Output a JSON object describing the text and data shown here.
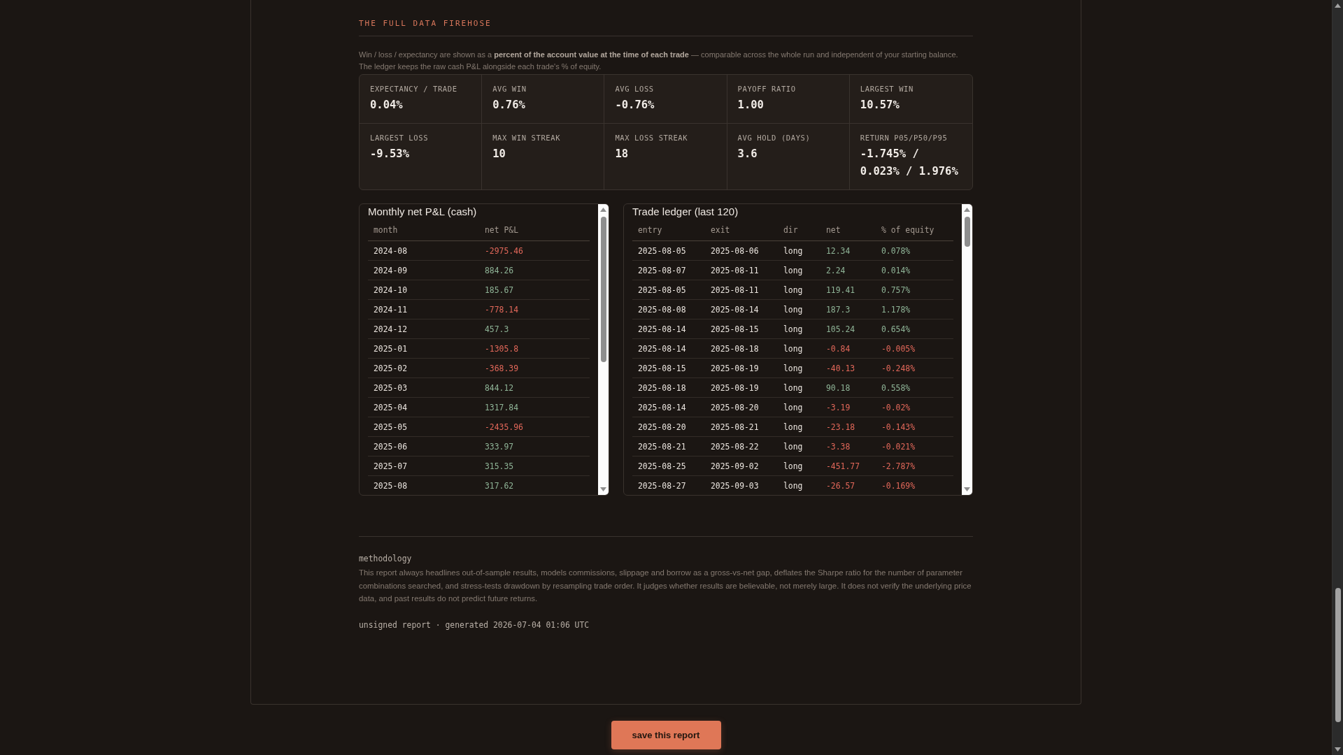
{
  "section": {
    "title": "THE FULL DATA FIREHOSE",
    "intro": "Win / loss / expectancy are shown as a **percent of the account value at the time of each trade** — comparable across the whole run and independent of your starting balance. The ledger keeps the raw cash P&L alongside each trade's % of equity."
  },
  "stats": [
    {
      "label": "EXPECTANCY / TRADE",
      "value": "0.04%"
    },
    {
      "label": "AVG WIN",
      "value": "0.76%"
    },
    {
      "label": "AVG LOSS",
      "value": "-0.76%"
    },
    {
      "label": "PAYOFF RATIO",
      "value": "1.00"
    },
    {
      "label": "LARGEST WIN",
      "value": "10.57%"
    },
    {
      "label": "LARGEST LOSS",
      "value": "-9.53%"
    },
    {
      "label": "MAX WIN STREAK",
      "value": "10"
    },
    {
      "label": "MAX LOSS STREAK",
      "value": "18"
    },
    {
      "label": "AVG HOLD (DAYS)",
      "value": "3.6"
    },
    {
      "label": "RETURN P05/P50/P95",
      "value": "-1.745% / 0.023% / 1.976%"
    }
  ],
  "monthly_table": {
    "title": "Monthly net P&L (cash)",
    "columns": [
      "month",
      "net P&L"
    ],
    "rows": [
      {
        "month": "2024-08",
        "net": "-2975.46",
        "negative": true
      },
      {
        "month": "2024-09",
        "net": "884.26",
        "negative": false
      },
      {
        "month": "2024-10",
        "net": "185.67",
        "negative": false
      },
      {
        "month": "2024-11",
        "net": "-778.14",
        "negative": true
      },
      {
        "month": "2024-12",
        "net": "457.3",
        "negative": false
      },
      {
        "month": "2025-01",
        "net": "-1305.8",
        "negative": true
      },
      {
        "month": "2025-02",
        "net": "-368.39",
        "negative": true
      },
      {
        "month": "2025-03",
        "net": "844.12",
        "negative": false
      },
      {
        "month": "2025-04",
        "net": "1317.84",
        "negative": false
      },
      {
        "month": "2025-05",
        "net": "-2435.96",
        "negative": true
      },
      {
        "month": "2025-06",
        "net": "333.97",
        "negative": false
      },
      {
        "month": "2025-07",
        "net": "315.35",
        "negative": false
      },
      {
        "month": "2025-08",
        "net": "317.62",
        "negative": false
      }
    ]
  },
  "trade_ledger": {
    "title": "Trade ledger (last 120)",
    "columns": [
      "entry",
      "exit",
      "dir",
      "net",
      "% of equity"
    ],
    "rows": [
      {
        "entry": "2025-08-05",
        "exit": "2025-08-06",
        "dir": "long",
        "net": "12.34",
        "pct": "0.078%",
        "negative": false
      },
      {
        "entry": "2025-08-07",
        "exit": "2025-08-11",
        "dir": "long",
        "net": "2.24",
        "pct": "0.014%",
        "negative": false
      },
      {
        "entry": "2025-08-05",
        "exit": "2025-08-11",
        "dir": "long",
        "net": "119.41",
        "pct": "0.757%",
        "negative": false
      },
      {
        "entry": "2025-08-08",
        "exit": "2025-08-14",
        "dir": "long",
        "net": "187.3",
        "pct": "1.178%",
        "negative": false
      },
      {
        "entry": "2025-08-14",
        "exit": "2025-08-15",
        "dir": "long",
        "net": "105.24",
        "pct": "0.654%",
        "negative": false
      },
      {
        "entry": "2025-08-14",
        "exit": "2025-08-18",
        "dir": "long",
        "net": "-0.84",
        "pct": "-0.005%",
        "negative": true
      },
      {
        "entry": "2025-08-15",
        "exit": "2025-08-19",
        "dir": "long",
        "net": "-40.13",
        "pct": "-0.248%",
        "negative": true
      },
      {
        "entry": "2025-08-18",
        "exit": "2025-08-19",
        "dir": "long",
        "net": "90.18",
        "pct": "0.558%",
        "negative": false
      },
      {
        "entry": "2025-08-14",
        "exit": "2025-08-20",
        "dir": "long",
        "net": "-3.19",
        "pct": "-0.02%",
        "negative": true
      },
      {
        "entry": "2025-08-20",
        "exit": "2025-08-21",
        "dir": "long",
        "net": "-23.18",
        "pct": "-0.143%",
        "negative": true
      },
      {
        "entry": "2025-08-21",
        "exit": "2025-08-22",
        "dir": "long",
        "net": "-3.38",
        "pct": "-0.021%",
        "negative": true
      },
      {
        "entry": "2025-08-25",
        "exit": "2025-09-02",
        "dir": "long",
        "net": "-451.77",
        "pct": "-2.787%",
        "negative": true
      },
      {
        "entry": "2025-08-27",
        "exit": "2025-09-03",
        "dir": "long",
        "net": "-26.57",
        "pct": "-0.169%",
        "negative": true
      }
    ]
  },
  "methodology": {
    "title": "methodology",
    "text": "This report always headlines out-of-sample results, models commissions, slippage and borrow as a gross-vs-net gap, deflates the Sharpe ratio for the number of parameter combinations searched, and stress-tests drawdown by resampling trade order. It judges whether results are believable, not merely large. It does not verify the underlying price data, and past results do not predict future returns."
  },
  "footer": "unsigned report · generated 2026-07-04 01:06 UTC",
  "save_button": "save this report"
}
